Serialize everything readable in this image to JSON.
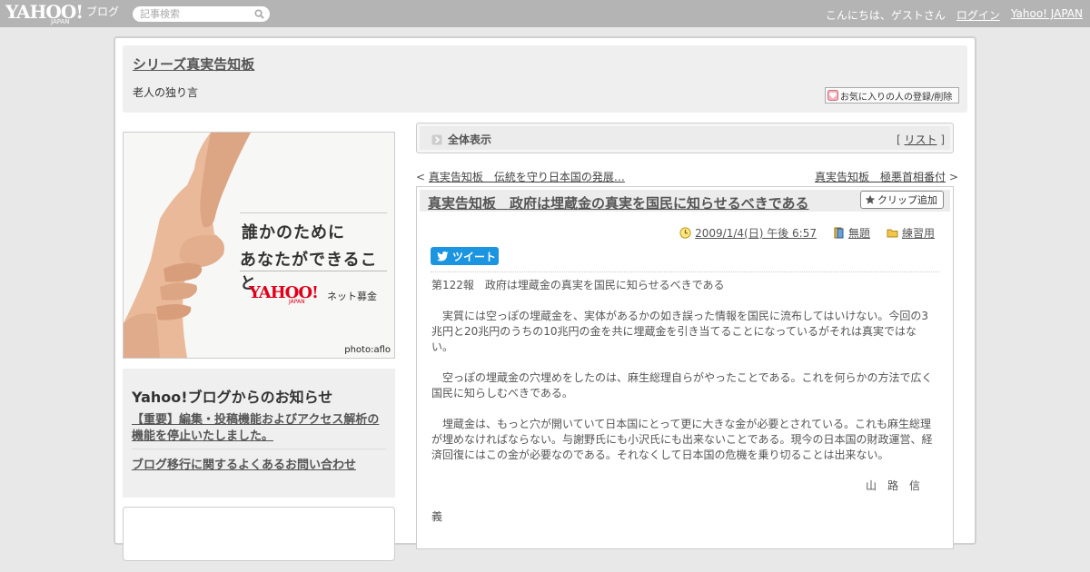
{
  "topbar": {
    "logo": "YAHOO!",
    "logo_sub": "JAPAN",
    "blog_label": "ブログ",
    "search_placeholder": "記事検索",
    "greeting": "こんにちは、ゲストさん",
    "login": "ログイン",
    "yahoo_japan": "Yahoo! JAPAN"
  },
  "header": {
    "title": "シリーズ真実告知板",
    "description": "老人の独り言",
    "fav_button": "お気に入りの人の登録/削除"
  },
  "ad": {
    "line1": "誰かのために",
    "line2": "あなたができること",
    "logo": "YAHOO!",
    "logo_sub": "JAPAN",
    "service": "ネット募金",
    "credit": "photo:aflo"
  },
  "notice": {
    "title": "Yahoo!ブログからのお知らせ",
    "link1": "【重要】編集・投稿機能およびアクセス解析の機能を停止いたしました。",
    "link2": "ブログ移行に関するよくあるお問い合わせ"
  },
  "viewall": {
    "label": "全体表示",
    "list_prefix": "[ ",
    "list_link": "リスト",
    "list_suffix": " ]"
  },
  "nav": {
    "prev_mark": "< ",
    "prev": "真実告知板　伝統を守り日本国の発展…",
    "next": "真実告知板　極悪首相番付",
    "next_mark": " >"
  },
  "article": {
    "title": "真実告知板　政府は埋蔵金の真実を国民に知らせるべきである",
    "clip_button": "クリップ追加",
    "date": "2009/1/4(日) 午後 6:57",
    "theme": "無題",
    "category": "練習用",
    "tweet": "ツイート",
    "paragraphs": [
      "第122報　政府は埋蔵金の真実を国民に知らせるべきである",
      "　実質には空っぽの埋蔵金を、実体があるかの如き誤った情報を国民に流布してはいけない。今回の3兆円と20兆円のうちの10兆円の金を共に埋蔵金を引き当てることになっているがそれは真実ではない。",
      "　空っぽの埋蔵金の穴埋めをしたのは、麻生総理自らがやったことである。これを何らかの方法で広く国民に知らしむべきである。",
      "　埋蔵金は、もっと穴が開いていて日本国にとって更に大きな金が必要とされている。これも麻生総理が埋めなければならない。与謝野氏にも小沢氏にも出来ないことである。現今の日本国の財政運営、経済回復にはこの金が必要なのである。それなくして日本国の危機を乗り切ることは出来ない。"
    ],
    "signature": "山　路　信",
    "signature_end": "義"
  }
}
